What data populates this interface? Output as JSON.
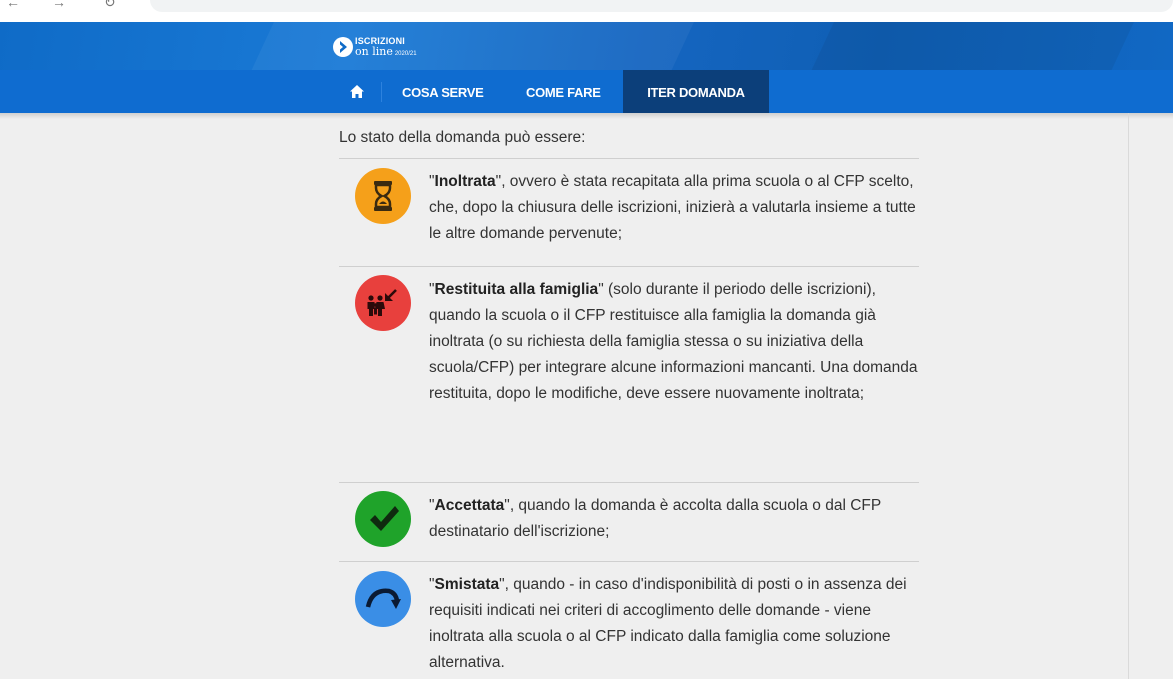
{
  "header": {
    "logo_top": "ISCRIZIONI",
    "logo_bottom": "on line",
    "logo_year": "2020/21"
  },
  "nav": {
    "home_icon": "home-icon",
    "items": [
      {
        "label": "COSA SERVE"
      },
      {
        "label": "COME FARE"
      },
      {
        "label": "ITER DOMANDA",
        "active": true
      }
    ]
  },
  "content": {
    "intro": "Lo stato della domanda può essere:",
    "items": [
      {
        "icon": "hourglass-icon",
        "color": "#f5a01a",
        "open_quote": "\"",
        "title": "Inoltrata",
        "close_quote": "\"",
        "text": ", ovvero è stata recapitata alla prima scuola o al CFP scelto, che, dopo la chiusura delle iscrizioni, inizierà a valutarla insieme a tutte le altre domande pervenute;"
      },
      {
        "icon": "family-return-icon",
        "color": "#e8403d",
        "open_quote": "\"",
        "title": "Restituita alla famiglia",
        "close_quote": "\"",
        "text": " (solo durante il periodo delle iscrizioni), quando la scuola o il CFP restituisce alla famiglia la domanda già inoltrata (o su richiesta della famiglia stessa o su iniziativa della scuola/CFP) per integrare alcune informazioni mancanti. Una domanda restituita, dopo le modifiche, deve essere nuovamente inoltrata;"
      },
      {
        "icon": "checkmark-icon",
        "color": "#1fa32a",
        "open_quote": "\"",
        "title": "Accettata",
        "close_quote": "\"",
        "text": ", quando la domanda è accolta dalla scuola o dal CFP destinatario dell'iscrizione;"
      },
      {
        "icon": "redirect-arrow-icon",
        "color": "#3a8ee6",
        "open_quote": "\"",
        "title": "Smistata",
        "close_quote": "\"",
        "text": ", quando - in caso d'indisponibilità di posti o in assenza dei requisiti indicati nei criteri di accoglimento delle domande - viene inoltrata alla scuola o al CFP indicato dalla famiglia come soluzione alternativa."
      }
    ]
  }
}
